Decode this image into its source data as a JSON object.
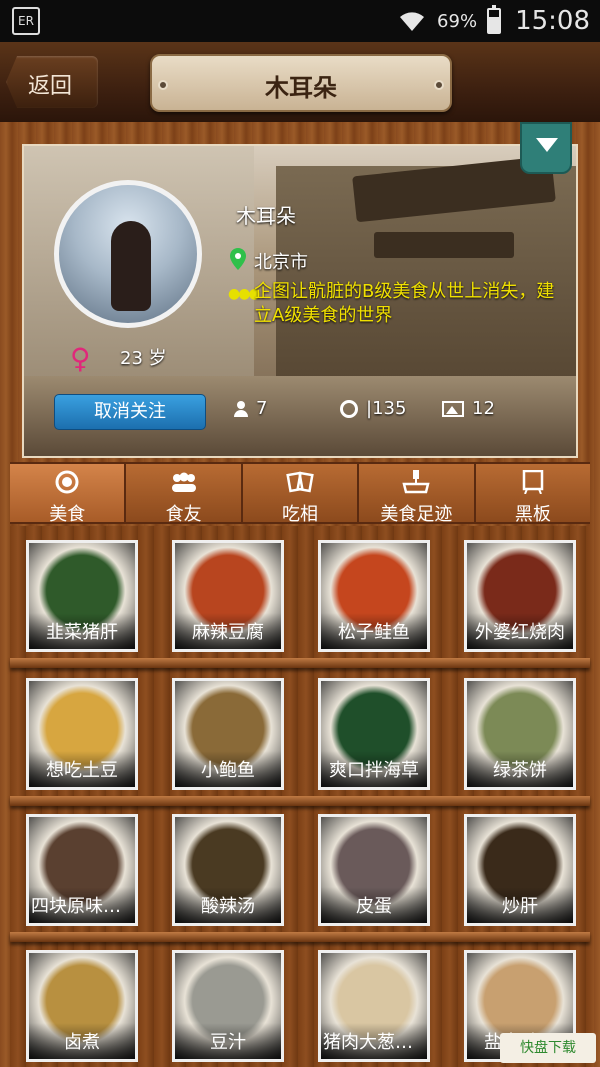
{
  "status_bar": {
    "left_icon": "sim-card-icon",
    "left_text": "ER",
    "battery_level": 0.69,
    "battery_percent": "69%",
    "time": "15:08"
  },
  "header": {
    "back_label": "返回",
    "title": "木耳朵"
  },
  "profile": {
    "name": "木耳朵",
    "city": "北京市",
    "bio": "企图让骯脏的B级美食从世上消失，建立A级美食的世界",
    "age": "23 岁",
    "follow_button": "取消关注",
    "friends_count": "7",
    "meals_count": "|135",
    "photos_count": "12"
  },
  "tabs": [
    {
      "label": "美食",
      "icon": "plate-icon",
      "active": true
    },
    {
      "label": "食友",
      "icon": "friends-icon",
      "active": false
    },
    {
      "label": "吃相",
      "icon": "cards-icon",
      "active": false
    },
    {
      "label": "美食足迹",
      "icon": "map-icon",
      "active": false
    },
    {
      "label": "黑板",
      "icon": "blackboard-icon",
      "active": false
    }
  ],
  "foods": [
    {
      "label": "韭菜猪肝",
      "color": "#2f5a2a"
    },
    {
      "label": "麻辣豆腐",
      "color": "#b8451f"
    },
    {
      "label": "松子鲑鱼",
      "color": "#c5461e"
    },
    {
      "label": "外婆红烧肉",
      "color": "#7a2a1a"
    },
    {
      "label": "想吃土豆",
      "color": "#d7a640"
    },
    {
      "label": "小鲍鱼",
      "color": "#8a6a38"
    },
    {
      "label": "爽口拌海草",
      "color": "#1f4f2a"
    },
    {
      "label": "绿茶饼",
      "color": "#7c8a56"
    },
    {
      "label": "四块原味排…",
      "color": "#5a4030"
    },
    {
      "label": "酸辣汤",
      "color": "#4a3a22"
    },
    {
      "label": "皮蛋",
      "color": "#6a5a5a"
    },
    {
      "label": "炒肝",
      "color": "#3a2a1a"
    },
    {
      "label": "卤煮",
      "color": "#b89040"
    },
    {
      "label": "豆汁",
      "color": "#9a9a92"
    },
    {
      "label": "猪肉大葱包…",
      "color": "#d9c6a2"
    },
    {
      "label": "盐水鸭肝",
      "color": "#c8a070"
    }
  ],
  "watermark": "快盘下载"
}
